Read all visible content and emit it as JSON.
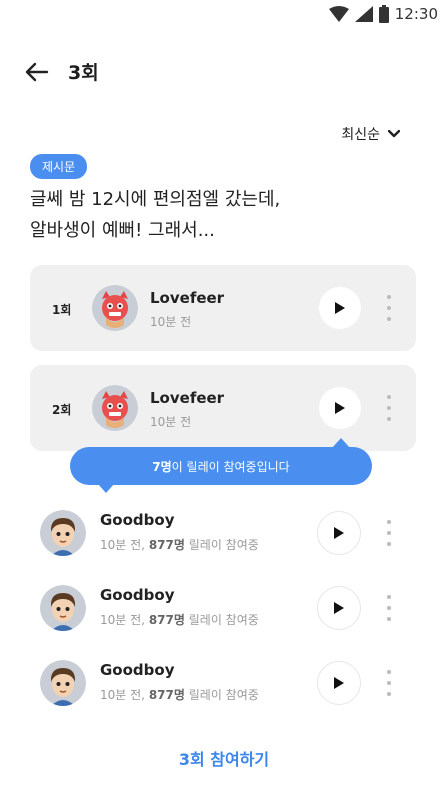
{
  "status_bar": {
    "time": "12:30",
    "icons": [
      "wifi-icon",
      "cellular-signal-icon",
      "battery-icon"
    ]
  },
  "header": {
    "back_icon": "arrow-left-icon",
    "title": "3회"
  },
  "sort": {
    "label": "최신순",
    "icon": "chevron-down-icon"
  },
  "prompt": {
    "badge": "제시문",
    "line1": "글쎄 밤 12시에 편의점엘 갔는데,",
    "line2": "알바생이 예뻐! 그래서..."
  },
  "rounds": [
    {
      "label": "1회",
      "name": "Lovefeer",
      "time": "10분 전"
    },
    {
      "label": "2회",
      "name": "Lovefeer",
      "time": "10분 전"
    }
  ],
  "tooltip": {
    "count": "7명",
    "text": "이 릴레이 참여중입니다"
  },
  "users": [
    {
      "name": "Goodboy",
      "time": "10분 전,",
      "count": "877명",
      "suffix": "릴레이 참여중"
    },
    {
      "name": "Goodboy",
      "time": "10분 전,",
      "count": "877명",
      "suffix": "릴레이 참여중"
    },
    {
      "name": "Goodboy",
      "time": "10분 전,",
      "count": "877명",
      "suffix": "릴레이 참여중"
    }
  ],
  "join_button": {
    "label": "3회 참여하기"
  },
  "colors": {
    "accent": "#4a8ff0",
    "card_bg": "#f0f0f0",
    "join_text": "#3d86ea"
  }
}
